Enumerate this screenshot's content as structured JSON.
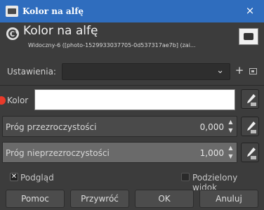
{
  "window": {
    "title": "Kolor na alfę",
    "close_glyph": "×"
  },
  "header": {
    "title": "Kolor na alfę",
    "subtitle": "Widoczny-6 ([photo-1529933037705-0d537317ae7b] (zai..."
  },
  "presets": {
    "label": "Ustawienia:",
    "value": ""
  },
  "color": {
    "label": "Kolor",
    "value": "#ffffff"
  },
  "transparency_threshold": {
    "label": "Próg przezroczystości",
    "value": "0,000",
    "fill_fraction": 0.0
  },
  "opacity_threshold": {
    "label": "Próg nieprzezroczystości",
    "value": "1,000",
    "fill_fraction": 1.0
  },
  "options": {
    "preview_label": "Podgląd",
    "preview_checked": true,
    "split_label": "Podzielony widok",
    "split_checked": false
  },
  "buttons": {
    "help": "Pomoc",
    "reset": "Przywróć",
    "ok": "OK",
    "cancel": "Anuluj"
  },
  "colors": {
    "titlebar": "#2f6dbe",
    "background": "#3c3c3c",
    "marker": "#e83a2a"
  }
}
